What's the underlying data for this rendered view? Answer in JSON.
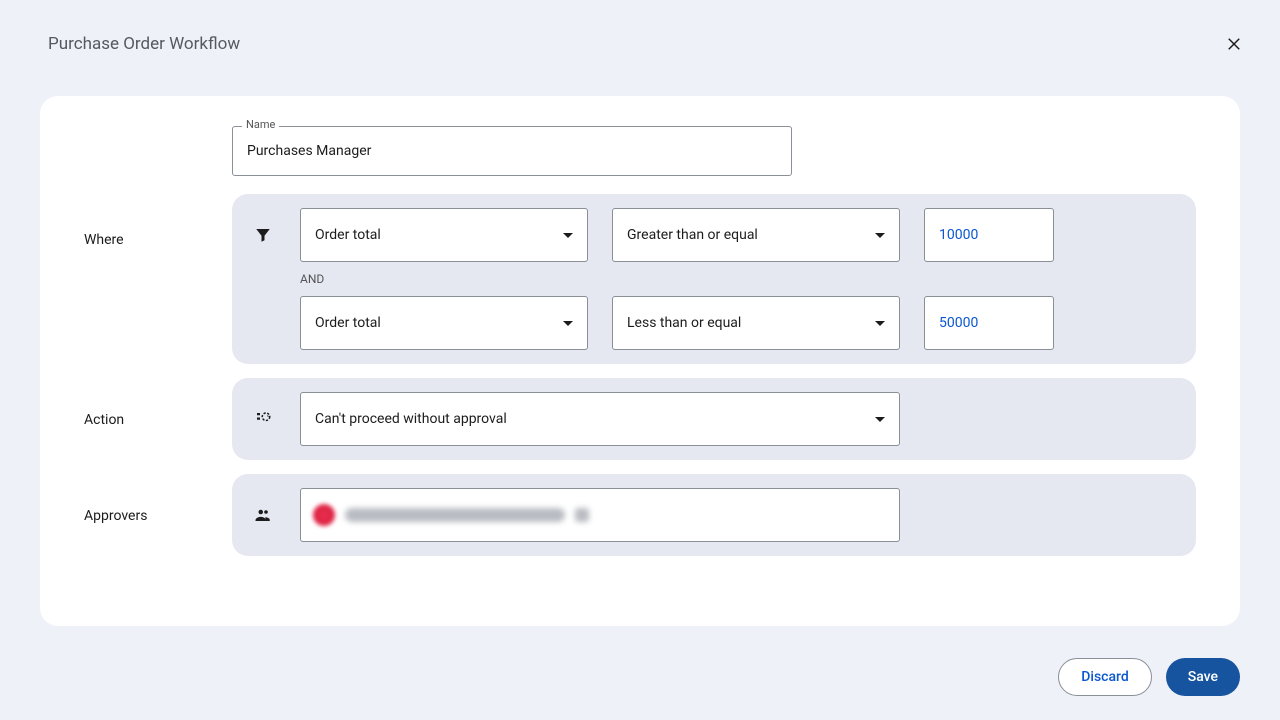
{
  "title": "Purchase Order Workflow",
  "name": {
    "label": "Name",
    "value": "Purchases Manager"
  },
  "sections": {
    "where": {
      "label": "Where",
      "and": "AND",
      "cond1": {
        "field": "Order total",
        "op": "Greater than or equal",
        "value": "10000"
      },
      "cond2": {
        "field": "Order total",
        "op": "Less than or equal",
        "value": "50000"
      }
    },
    "action": {
      "label": "Action",
      "value": "Can't proceed without approval"
    },
    "approvers": {
      "label": "Approvers"
    }
  },
  "buttons": {
    "discard": "Discard",
    "save": "Save"
  }
}
